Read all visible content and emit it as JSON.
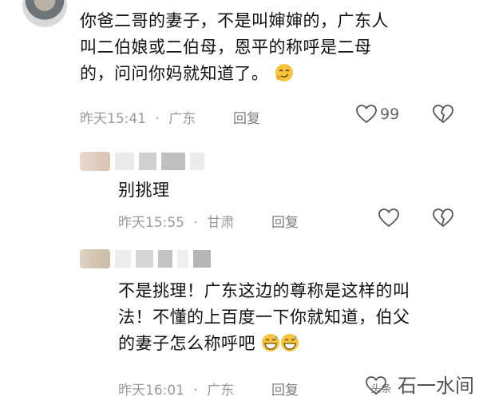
{
  "comments": [
    {
      "text_lines": [
        "你爸二哥的妻子，不是叫婶婶的，广东人",
        "叫二伯娘或二伯母，恩平的称呼是二母",
        "的，问问你妈就知道了。"
      ],
      "time": "昨天15:41",
      "location": "广东",
      "reply_label": "回复",
      "like_count": "99",
      "emoji": "smirk-face"
    },
    {
      "text_lines": [
        "别挑理"
      ],
      "time": "昨天15:55",
      "location": "甘肃",
      "reply_label": "回复",
      "like_count": ""
    },
    {
      "text_lines": [
        "不是挑理！广东这边的尊称是这样的叫",
        "法！不懂的上百度一下你就知道，伯父",
        "的妻子怎么称呼吧"
      ],
      "time": "昨天16:01",
      "location": "广东",
      "reply_label": "回复",
      "like_count": "",
      "emoji": "grinning-sweat-face"
    }
  ],
  "separator": "·",
  "watermark": {
    "text": "石一水间",
    "small": "头条"
  },
  "colors": {
    "meta": "#9a9a9a",
    "text": "#111111",
    "emoji": "#f7c43b"
  }
}
